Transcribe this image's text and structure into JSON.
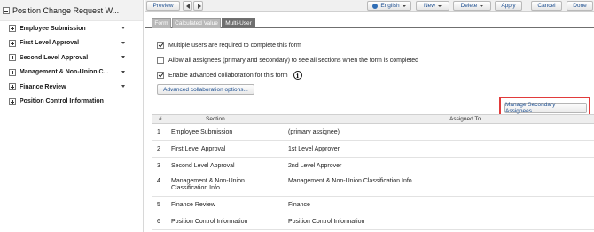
{
  "tree": {
    "root_label": "Position Change Request W...",
    "items": [
      {
        "label": "Employee Submission"
      },
      {
        "label": "First Level Approval"
      },
      {
        "label": "Second Level Approval"
      },
      {
        "label": "Management & Non-Union C..."
      },
      {
        "label": "Finance Review"
      },
      {
        "label": "Position Control Information"
      }
    ]
  },
  "toolbar": {
    "preview_label": "Preview",
    "language_label": "English",
    "new_label": "New",
    "delete_label": "Delete",
    "apply_label": "Apply",
    "cancel_label": "Cancel",
    "done_label": "Done"
  },
  "tabs": [
    {
      "label": "Form",
      "active": false
    },
    {
      "label": "Calculated Value",
      "active": false
    },
    {
      "label": "Multi-User",
      "active": true
    }
  ],
  "options": {
    "multiple_users": {
      "label": "Multiple users are required to complete this form",
      "checked": true
    },
    "allow_all": {
      "label": "Allow all assignees (primary and secondary) to see all sections when the form is completed",
      "checked": false
    },
    "advanced_collab": {
      "label": "Enable advanced collaboration for this form",
      "checked": true
    },
    "info_glyph": "i"
  },
  "buttons": {
    "advanced_options_label": "Advanced collaboration options...",
    "manage_secondary_label": "Manage Secondary Assignees..."
  },
  "table": {
    "headers": {
      "num": "#",
      "section": "Section",
      "assigned": "Assigned To"
    },
    "rows": [
      {
        "num": "1",
        "section": "Employee Submission",
        "assigned": "(primary assignee)"
      },
      {
        "num": "2",
        "section": "First Level Approval",
        "assigned": "1st Level Approver"
      },
      {
        "num": "3",
        "section": "Second Level Approval",
        "assigned": "2nd Level Approver"
      },
      {
        "num": "4",
        "section": "Management & Non-Union Classification Info",
        "assigned": "Management & Non-Union Classification Info"
      },
      {
        "num": "5",
        "section": "Finance Review",
        "assigned": "Finance"
      },
      {
        "num": "6",
        "section": "Position Control Information",
        "assigned": "Position Control Information"
      }
    ]
  },
  "colors": {
    "highlight": "#e13b3b",
    "active_tab": "#6f6f6f",
    "link_text": "#1d4f91"
  }
}
